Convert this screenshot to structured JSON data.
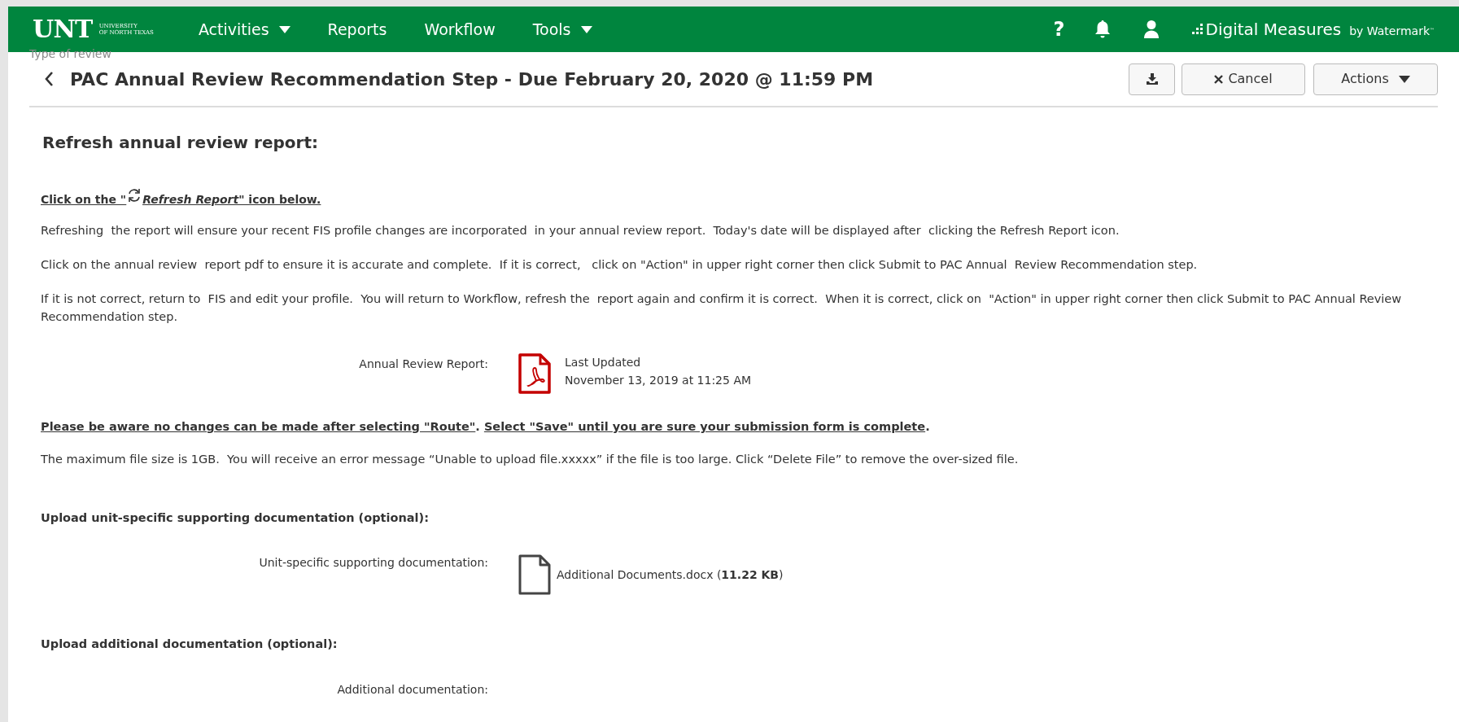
{
  "nav": {
    "logo": "UNT",
    "logo_sub": [
      "UNIVERSITY",
      "OF NORTH TEXAS"
    ],
    "items": [
      {
        "label": "Activities",
        "dropdown": true
      },
      {
        "label": "Reports",
        "dropdown": false
      },
      {
        "label": "Workflow",
        "dropdown": false
      },
      {
        "label": "Tools",
        "dropdown": true
      }
    ],
    "help": "?",
    "brand": "Digital Measures",
    "brand_by": "by Watermark",
    "brand_tm": "™"
  },
  "ghost_text": "Type of review",
  "title": "PAC Annual Review Recommendation Step - Due February 20, 2020 @ 11:59 PM",
  "buttons": {
    "cancel": "Cancel",
    "actions": "Actions"
  },
  "section_heading": "Refresh annual review report:",
  "instruction": {
    "before": "Click on the \"",
    "link": "Refresh Report",
    "after": "\" icon below."
  },
  "paragraphs": [
    "Refreshing  the report will ensure your recent FIS profile changes are incorporated  in your annual review report.  Today's date will be displayed after  clicking the Refresh Report icon.",
    "Click on the annual review  report pdf to ensure it is accurate and complete.  If it is correct,   click on \"Action\" in upper right corner then click Submit to PAC Annual  Review Recommendation step.",
    "If it is not correct, return to  FIS and edit your profile.  You will return to Workflow, refresh the  report again and confirm it is correct.  When it is correct, click on  \"Action\" in upper right corner then click Submit to PAC Annual Review  Recommendation step."
  ],
  "report": {
    "label": "Annual Review Report:",
    "updated_label": "Last Updated",
    "updated_value": "November 13, 2019 at 11:25 AM"
  },
  "warning": [
    "Please be aware no changes can be made after selecting \"Route\"",
    ". ",
    "Select \"Save\" until you are sure your submission form is complete",
    "."
  ],
  "file_note": "The maximum file size is 1GB.  You will receive an error message “Unable to upload file.xxxxx” if the file is too large. Click “Delete File” to remove the over-sized file.",
  "uploads": [
    {
      "heading": "Upload unit-specific supporting documentation (optional):",
      "label": "Unit-specific supporting documentation:",
      "file": "Additional Documents.docx (**11.22 KB**)"
    },
    {
      "heading": "Upload additional documentation (optional):",
      "label": "Additional documentation:"
    }
  ]
}
